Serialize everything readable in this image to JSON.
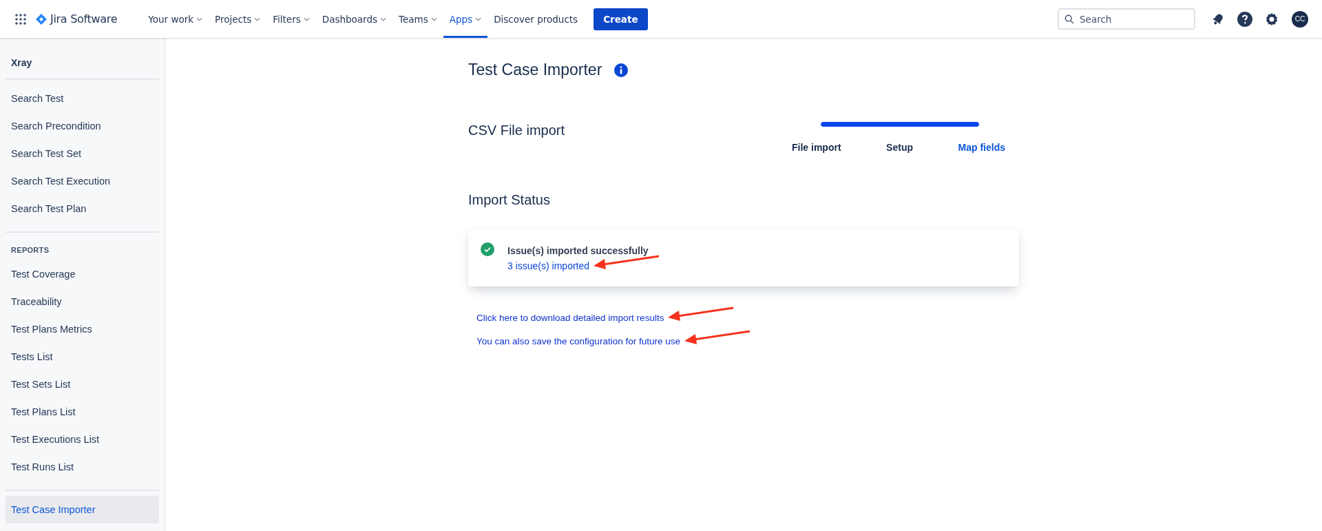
{
  "topbar": {
    "product": "Jira Software",
    "nav": [
      {
        "label": "Your work",
        "dropdown": true,
        "selected": false
      },
      {
        "label": "Projects",
        "dropdown": true,
        "selected": false
      },
      {
        "label": "Filters",
        "dropdown": true,
        "selected": false
      },
      {
        "label": "Dashboards",
        "dropdown": true,
        "selected": false
      },
      {
        "label": "Teams",
        "dropdown": true,
        "selected": false
      },
      {
        "label": "Apps",
        "dropdown": true,
        "selected": true
      },
      {
        "label": "Discover products",
        "dropdown": false,
        "selected": false
      }
    ],
    "create_button": "Create",
    "search": {
      "placeholder": "Search"
    },
    "avatar": "CC"
  },
  "sidebar": {
    "title": "Xray",
    "groups": [
      {
        "items": [
          {
            "label": "Search Test",
            "selected": false
          },
          {
            "label": "Search Precondition",
            "selected": false
          },
          {
            "label": "Search Test Set",
            "selected": false
          },
          {
            "label": "Search Test Execution",
            "selected": false
          },
          {
            "label": "Search Test Plan",
            "selected": false
          }
        ]
      },
      {
        "heading": "REPORTS",
        "items": [
          {
            "label": "Test Coverage",
            "selected": false
          },
          {
            "label": "Traceability",
            "selected": false
          },
          {
            "label": "Test Plans Metrics",
            "selected": false
          },
          {
            "label": "Tests List",
            "selected": false
          },
          {
            "label": "Test Sets List",
            "selected": false
          },
          {
            "label": "Test Plans List",
            "selected": false
          },
          {
            "label": "Test Executions List",
            "selected": false
          },
          {
            "label": "Test Runs List",
            "selected": false
          }
        ]
      },
      {
        "items": [
          {
            "label": "Test Case Importer",
            "selected": true
          }
        ]
      }
    ]
  },
  "main": {
    "title": "Test Case Importer",
    "section": "CSV File import",
    "progress": {
      "level": 1,
      "steps": [
        {
          "label": "File import",
          "selected": false
        },
        {
          "label": "Setup",
          "selected": false
        },
        {
          "label": "Map fields",
          "selected": true
        }
      ]
    },
    "status_heading": "Import Status",
    "status_card": {
      "kind": "success",
      "message": "Issue(s) imported successfully",
      "link": {
        "text": "3 issue(s) imported",
        "arrow_marked": true
      }
    },
    "links": [
      {
        "text": "Click here to download detailed import results",
        "arrow_marked": true
      },
      {
        "text": "You can also save the configuration for future use",
        "arrow_marked": true
      }
    ]
  }
}
